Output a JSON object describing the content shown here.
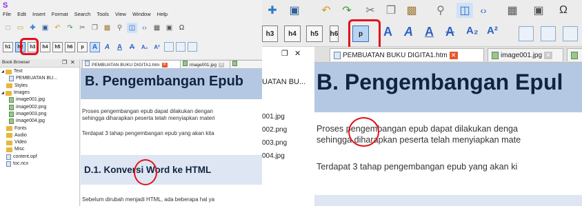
{
  "app": {
    "logo_glyph": "S"
  },
  "menu": [
    "File",
    "Edit",
    "Insert",
    "Format",
    "Search",
    "Tools",
    "View",
    "Window",
    "Help"
  ],
  "heading_buttons": [
    "h1",
    "h2",
    "h3",
    "h4",
    "h5",
    "h6",
    "p"
  ],
  "format_buttons": [
    {
      "label": "A",
      "icon": "bold-icon"
    },
    {
      "label": "A",
      "icon": "italic-icon"
    },
    {
      "label": "A",
      "icon": "underline-icon"
    },
    {
      "label": "A",
      "icon": "strikethrough-icon"
    },
    {
      "label": "A₂",
      "icon": "subscript-icon"
    },
    {
      "label": "A²",
      "icon": "superscript-icon"
    }
  ],
  "book_browser": {
    "title": "Book Browser",
    "dock_icons": [
      "❐",
      "✕"
    ],
    "tree": [
      {
        "label": "Text",
        "type": "folder",
        "indent": 0,
        "expander": "◢"
      },
      {
        "label": "PEMBUATAN BU...",
        "type": "doc",
        "indent": 1
      },
      {
        "label": "Styles",
        "type": "folder",
        "indent": 0
      },
      {
        "label": "Images",
        "type": "folder",
        "indent": 0,
        "expander": "◢"
      },
      {
        "label": "image001.jpg",
        "type": "file",
        "indent": 1
      },
      {
        "label": "image002.png",
        "type": "file",
        "indent": 1
      },
      {
        "label": "image003.png",
        "type": "file",
        "indent": 1
      },
      {
        "label": "image004.jpg",
        "type": "file",
        "indent": 1
      },
      {
        "label": "Fonts",
        "type": "folder",
        "indent": 0
      },
      {
        "label": "Audio",
        "type": "folder",
        "indent": 0
      },
      {
        "label": "Video",
        "type": "folder",
        "indent": 0
      },
      {
        "label": "Misc",
        "type": "folder",
        "indent": 0
      },
      {
        "label": "content.opf",
        "type": "plain",
        "indent": 0
      },
      {
        "label": "toc.ncx",
        "type": "plain",
        "indent": 0
      }
    ]
  },
  "tabs": [
    {
      "label": "PEMBUATAN BUKU DIGITA1.htm",
      "close": "✕"
    },
    {
      "label": "image001.jpg",
      "close": "✕"
    }
  ],
  "editor": {
    "heading": "B.  Pengembangan Epub",
    "paragraph1_line1": "Proses pengembangan epub dapat dilakukan dengan",
    "paragraph1_line2": "sehingga diharapkan peserta telah menyiapkan materi",
    "paragraph2": "Terdapat 3 tahap pengembangan epub yang akan kita",
    "subheading": "D.1.  Konversi Word ke HTML",
    "paragraph3": "Sebelum dirubah menjadi HTML, ada beberapa hal ya"
  },
  "overflow_text": {
    "behind_tab": "UATAN BU...",
    "files": [
      "001.jpg",
      "002.png",
      "003.png",
      "004.jpg"
    ]
  },
  "right_editor": {
    "heading": "B.  Pengembangan Epul",
    "paragraph1_line1": "Proses pengembangan epub dapat dilakukan denga",
    "paragraph1_line2": "sehingga diharapkan peserta telah menyiapkan mate",
    "paragraph2": "Terdapat 3 tahap pengembangan epub yang akan ki"
  },
  "right_tabs": [
    {
      "label": "PEMBUATAN BUKU DIGITA1.htm",
      "close": "✕"
    },
    {
      "label": "image001.jpg",
      "close": "✕"
    }
  ],
  "colors": {
    "accent_red": "#e3101b",
    "heading_band": "#b4c8e4",
    "link_blue": "#2e62c2"
  }
}
